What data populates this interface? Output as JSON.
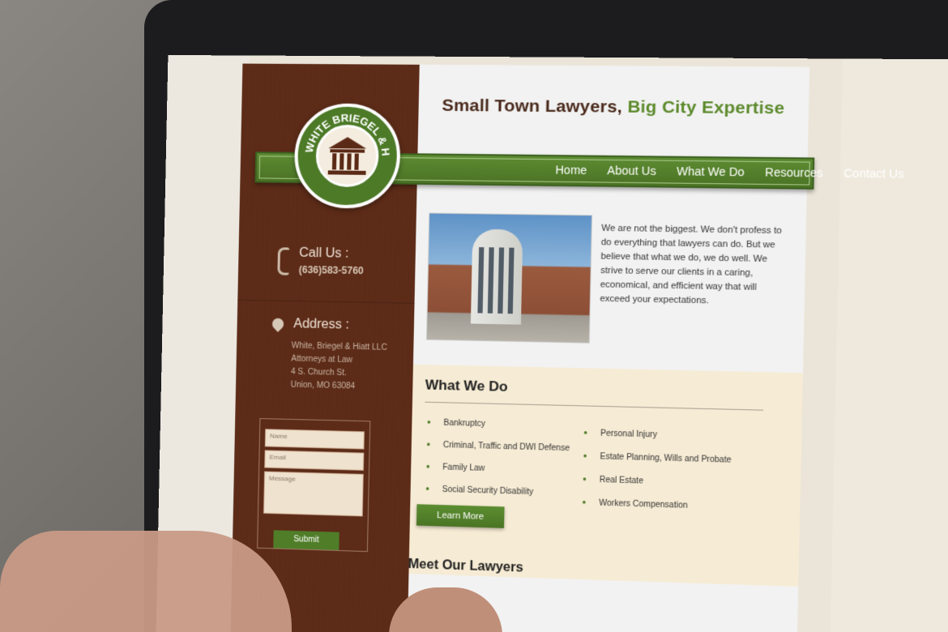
{
  "site": {
    "tagline_main": "Small Town Lawyers,",
    "tagline_highlight": "Big City Expertise",
    "logo_text": "WHITE BRIEGEL & HIATT LLC"
  },
  "nav": {
    "items": [
      "Home",
      "About Us",
      "What We Do",
      "Resources",
      "Contact Us"
    ]
  },
  "sidebar": {
    "call_title": "Call Us :",
    "call_phone": "(636)583-5760",
    "address_title": "Address :",
    "address_lines": [
      "White, Briegel & Hiatt LLC",
      "Attorneys at Law",
      "4 S. Church St.",
      "Union, MO 63084"
    ],
    "form": {
      "name_placeholder": "Name",
      "email_placeholder": "Email",
      "message_placeholder": "Message",
      "submit_label": "Submit"
    }
  },
  "intro": {
    "text": "We are not the biggest. We don't profess to do everything that lawyers can do. But we believe that what we do, we do well. We strive to serve our clients in a caring, economical, and efficient way that will exceed your expectations."
  },
  "what_we_do": {
    "title": "What We Do",
    "services_left": [
      "Bankruptcy",
      "Criminal, Traffic and DWI Defense",
      "Family Law",
      "Social Security Disability"
    ],
    "services_right": [
      "Personal Injury",
      "Estate Planning, Wills and Probate",
      "Real Estate",
      "Workers Compensation"
    ],
    "button_label": "Learn More"
  },
  "meet": {
    "title": "Meet Our Lawyers"
  },
  "colors": {
    "brown": "#5b2a17",
    "green": "#4f7d28",
    "cream": "#f6ebd4"
  }
}
